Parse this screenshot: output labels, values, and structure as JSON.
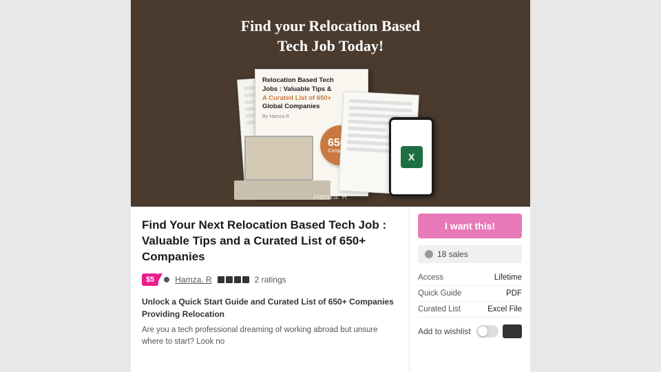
{
  "hero": {
    "title": "Find your Relocation Based\nTech Job Today!",
    "author_credit": "Hamza. R"
  },
  "book": {
    "main_title_line1": "Relocation Based Tech",
    "main_title_line2": "Jobs : Valuable Tips &",
    "main_title_highlight": "A Curated List of 650+",
    "main_title_line3": "Global Companies",
    "author": "By Hamza R",
    "badge_number": "650+",
    "badge_sub": "Companies"
  },
  "product": {
    "title": "Find Your Next Relocation Based Tech Job : Valuable Tips and a Curated List of 650+ Companies",
    "price": "$5",
    "author_name": "Hamza. R",
    "ratings_count": "2 ratings",
    "description_bold": "Unlock a Quick Start Guide and Curated List of 650+ Companies Providing Relocation",
    "description_text": "Are you a tech professional dreaming of working abroad but unsure where to start? Look no"
  },
  "sidebar": {
    "buy_button_label": "I want this!",
    "sales_count": "18 sales",
    "access_label": "Access",
    "access_value": "Lifetime",
    "quick_guide_label": "Quick Guide",
    "quick_guide_value": "PDF",
    "curated_list_label": "Curated List",
    "curated_list_value": "Excel File",
    "wishlist_label": "Add to wishlist"
  }
}
